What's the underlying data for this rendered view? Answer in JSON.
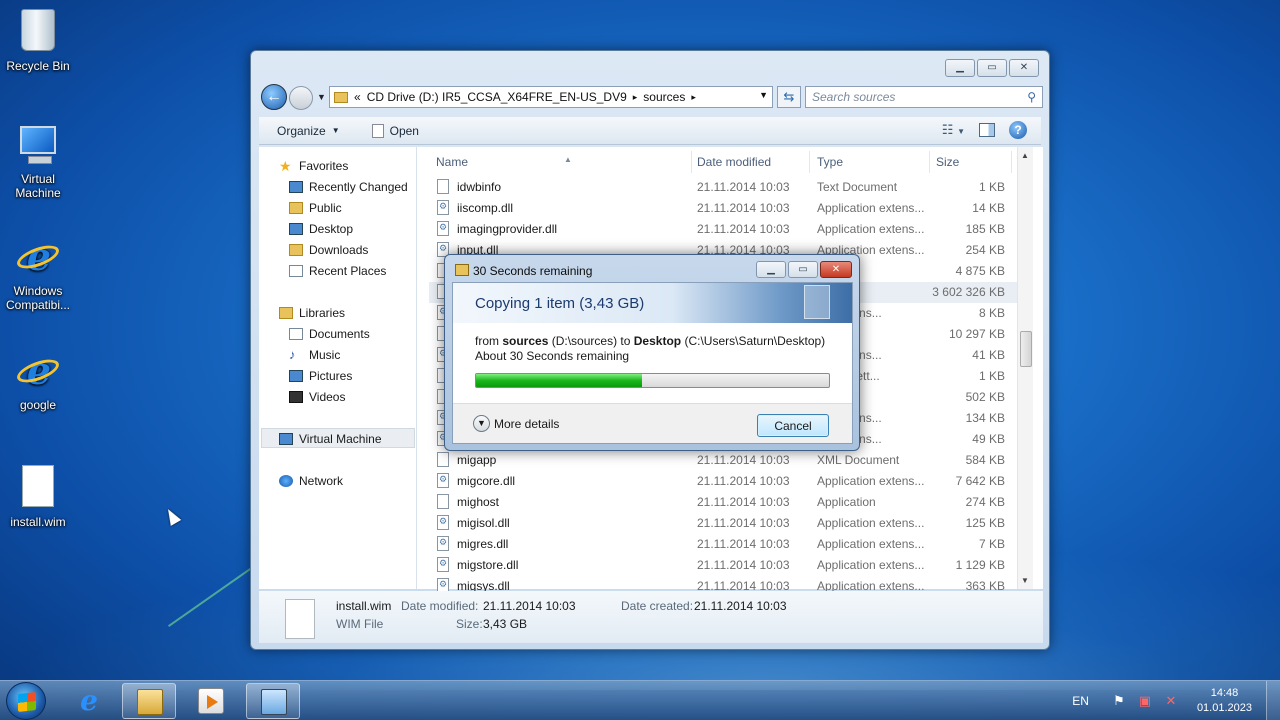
{
  "desktop": {
    "icons": [
      {
        "label": "Recycle Bin",
        "icon": "recycle-bin-icon"
      },
      {
        "label": "Virtual Machine",
        "icon": "computer-icon"
      },
      {
        "label": "Windows Compatibi...",
        "icon": "internet-explorer-icon"
      },
      {
        "label": "google",
        "icon": "internet-explorer-icon"
      },
      {
        "label": "install.wim",
        "icon": "file-icon"
      }
    ]
  },
  "explorer": {
    "address": {
      "chevron": "«",
      "path": [
        "CD Drive (D:) IR5_CCSA_X64FRE_EN-US_DV9",
        "sources"
      ],
      "separator": "▸"
    },
    "search_placeholder": "Search sources",
    "toolbar": {
      "organize": "Organize",
      "open": "Open"
    },
    "nav": {
      "favorites": "Favorites",
      "favorites_items": [
        "Recently Changed",
        "Public",
        "Desktop",
        "Downloads",
        "Recent Places"
      ],
      "libraries": "Libraries",
      "libraries_items": [
        "Documents",
        "Music",
        "Pictures",
        "Videos"
      ],
      "computer": "Virtual Machine",
      "network": "Network"
    },
    "columns": {
      "name": "Name",
      "date": "Date modified",
      "type": "Type",
      "size": "Size"
    },
    "files": [
      {
        "name": "idwbinfo",
        "date": "21.11.2014 10:03",
        "type": "Text Document",
        "size": "1 KB",
        "icon": "text"
      },
      {
        "name": "iiscomp.dll",
        "date": "21.11.2014 10:03",
        "type": "Application extens...",
        "size": "14 KB",
        "icon": "dll"
      },
      {
        "name": "imagingprovider.dll",
        "date": "21.11.2014 10:03",
        "type": "Application extens...",
        "size": "185 KB",
        "icon": "dll"
      },
      {
        "name": "input.dll",
        "date": "21.11.2014 10:03",
        "type": "Application extens...",
        "size": "254 KB",
        "icon": "dll"
      },
      {
        "name": "",
        "date": "",
        "type": "ion",
        "size": "4 875 KB",
        "icon": "app"
      },
      {
        "name": "",
        "date": "",
        "type": "e",
        "size": "3 602 326 KB",
        "icon": "file"
      },
      {
        "name": "",
        "date": "",
        "type": "ion extens...",
        "size": "8 KB",
        "icon": "dll"
      },
      {
        "name": "",
        "date": "",
        "type": "ion",
        "size": "10 297 KB",
        "icon": "app"
      },
      {
        "name": "",
        "date": "",
        "type": "ion extens...",
        "size": "41 KB",
        "icon": "dll"
      },
      {
        "name": "",
        "date": "",
        "type": "ration sett...",
        "size": "1 KB",
        "icon": "file"
      },
      {
        "name": "",
        "date": "",
        "type": "",
        "size": "502 KB",
        "icon": "file"
      },
      {
        "name": "",
        "date": "",
        "type": "ion extens...",
        "size": "134 KB",
        "icon": "dll"
      },
      {
        "name": "",
        "date": "",
        "type": "ion extens...",
        "size": "49 KB",
        "icon": "dll"
      },
      {
        "name": "migapp",
        "date": "21.11.2014 10:03",
        "type": "XML Document",
        "size": "584 KB",
        "icon": "file"
      },
      {
        "name": "migcore.dll",
        "date": "21.11.2014 10:03",
        "type": "Application extens...",
        "size": "7 642 KB",
        "icon": "dll"
      },
      {
        "name": "mighost",
        "date": "21.11.2014 10:03",
        "type": "Application",
        "size": "274 KB",
        "icon": "app"
      },
      {
        "name": "migisol.dll",
        "date": "21.11.2014 10:03",
        "type": "Application extens...",
        "size": "125 KB",
        "icon": "dll"
      },
      {
        "name": "migres.dll",
        "date": "21.11.2014 10:03",
        "type": "Application extens...",
        "size": "7 KB",
        "icon": "dll"
      },
      {
        "name": "migstore.dll",
        "date": "21.11.2014 10:03",
        "type": "Application extens...",
        "size": "1 129 KB",
        "icon": "dll"
      },
      {
        "name": "migsys.dll",
        "date": "21.11.2014 10:03",
        "type": "Application extens...",
        "size": "363 KB",
        "icon": "dll"
      }
    ],
    "details": {
      "filename": "install.wim",
      "filetype": "WIM File",
      "modified_label": "Date modified:",
      "modified_value": "21.11.2014 10:03",
      "created_label": "Date created:",
      "created_value": "21.11.2014 10:03",
      "size_label": "Size:",
      "size_value": "3,43 GB"
    }
  },
  "copy_dialog": {
    "title": "30 Seconds remaining",
    "heading": "Copying 1 item (3,43 GB)",
    "from_prefix": "from",
    "source_name": "sources",
    "source_path": "(D:\\sources)",
    "to_word": "to",
    "dest_name": "Desktop",
    "dest_path": "(C:\\Users\\Saturn\\Desktop)",
    "remaining": "About 30 Seconds remaining",
    "progress_percent": 47,
    "more_details": "More details",
    "cancel": "Cancel",
    "progress_color": "#1cb81c"
  },
  "taskbar": {
    "language": "EN",
    "time": "14:48",
    "date": "01.01.2023"
  }
}
